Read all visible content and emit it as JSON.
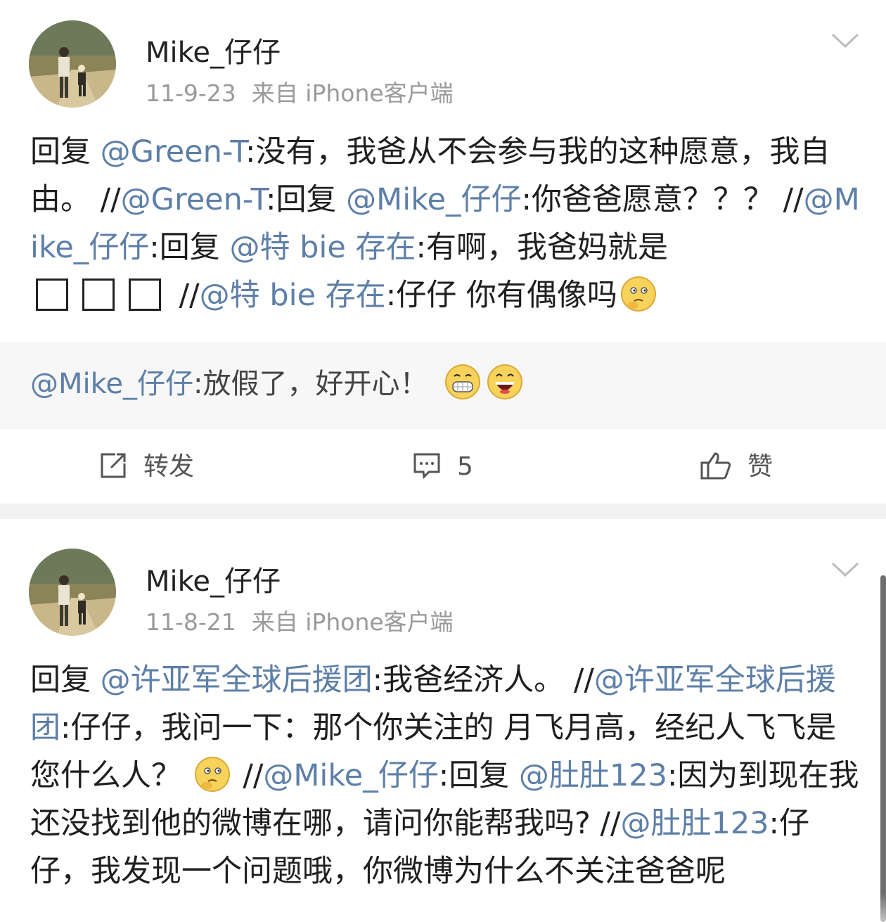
{
  "posts": [
    {
      "username": "Mike_仔仔",
      "date": "11-9-23",
      "source": "来自 iPhone客户端",
      "body": {
        "p1": "回复 ",
        "m1": "@Green-T",
        "p2": ":没有，我爸从不会参与我的这种愿意，我自由。 //",
        "m2": "@Green-T",
        "p3": ":回复 ",
        "m3": "@Mike_仔仔",
        "p4": ":你爸爸愿意？？？ //",
        "m4": "@Mike_仔仔",
        "p5": ":回复 ",
        "m5": "@特 bie 存在",
        "p6": ":有啊，我爸妈就是",
        "p7": "//",
        "m6": "@特 bie 存在",
        "p8": ":仔仔 你有偶像吗"
      },
      "repost": {
        "mention": "@Mike_仔仔",
        "text": ":放假了，好开心！"
      },
      "actions": {
        "repost_label": "转发",
        "comment_count": "5",
        "like_label": "赞"
      }
    },
    {
      "username": "Mike_仔仔",
      "date": "11-8-21",
      "source": "来自 iPhone客户端",
      "body": {
        "p1": "回复 ",
        "m1": "@许亚军全球后援团",
        "p2": ":我爸经济人。 //",
        "m2": "@许亚军全球后援团",
        "p3": ":仔仔，我问一下：那个你关注的 月飞月高，经纪人飞飞是您什么人？ ",
        "p4": " //",
        "m3": "@Mike_仔仔",
        "p5": ":回复 ",
        "m4": "@肚肚123",
        "p6": ":因为到现在我还没找到他的微博在哪，请问你能帮我吗? //",
        "m5": "@肚肚123",
        "p7": ":仔仔，我发现一个问题哦，你微博为什么不关注爸爸呢"
      }
    }
  ],
  "colors": {
    "mention": "#5d7fa8",
    "text": "#1f1f1f",
    "meta": "#9a9a9a"
  },
  "icons": [
    "avatar-photo",
    "chevron-down-icon",
    "smile-emoji",
    "grin-emoji",
    "laugh-emoji",
    "repost-icon",
    "comment-icon",
    "like-icon"
  ]
}
